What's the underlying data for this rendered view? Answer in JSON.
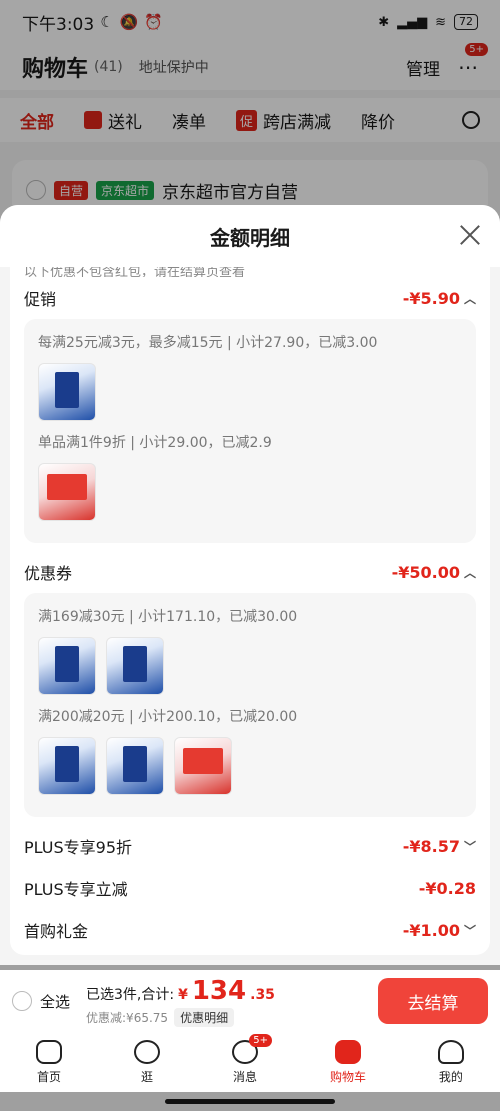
{
  "status_bar": {
    "time": "下午3:03",
    "battery": "72"
  },
  "header": {
    "title": "购物车",
    "count": "(41)",
    "address": "地址保护中",
    "manage": "管理",
    "more_badge": "5+"
  },
  "tabs": [
    "全部",
    "送礼",
    "凑单",
    "跨店满减",
    "降价"
  ],
  "promo_chip": "促",
  "store": {
    "tag1": "自营",
    "tag2": "京东超市",
    "name": "京东超市官方自营"
  },
  "sheet": {
    "title": "金额明细",
    "cut_note": "以下优惠不包含红包，请在结算页查看",
    "promo": {
      "label": "促销",
      "amount": "-¥5.90",
      "rules": [
        {
          "text": "每满25元减3元，最多减15元 | 小计27.90，已减3.00",
          "thumbs": [
            "blue"
          ]
        },
        {
          "text": "单品满1件9折 | 小计29.00，已减2.9",
          "thumbs": [
            "red"
          ]
        }
      ]
    },
    "coupon": {
      "label": "优惠券",
      "amount": "-¥50.00",
      "rules": [
        {
          "text": "满169减30元 | 小计171.10，已减30.00",
          "thumbs": [
            "blue",
            "blue"
          ]
        },
        {
          "text": "满200减20元 | 小计200.10，已减20.00",
          "thumbs": [
            "blue",
            "blue",
            "red"
          ]
        }
      ]
    },
    "plus_discount": {
      "label": "PLUS专享95折",
      "amount": "-¥8.57"
    },
    "plus_instant": {
      "label": "PLUS专享立减",
      "amount": "-¥0.28"
    },
    "first_gift": {
      "label": "首购礼金",
      "amount": "-¥1.00"
    }
  },
  "bottom": {
    "select_all": "全选",
    "summary": "已选3件,合计:",
    "currency": "¥",
    "total_int": "134",
    "total_dec": ".35",
    "discount": "优惠减:¥65.75",
    "detail_chip": "优惠明细",
    "checkout": "去结算"
  },
  "nav": [
    {
      "label": "首页",
      "badge": ""
    },
    {
      "label": "逛",
      "badge": ""
    },
    {
      "label": "消息",
      "badge": "5+"
    },
    {
      "label": "购物车",
      "badge": ""
    },
    {
      "label": "我的",
      "badge": ""
    }
  ]
}
